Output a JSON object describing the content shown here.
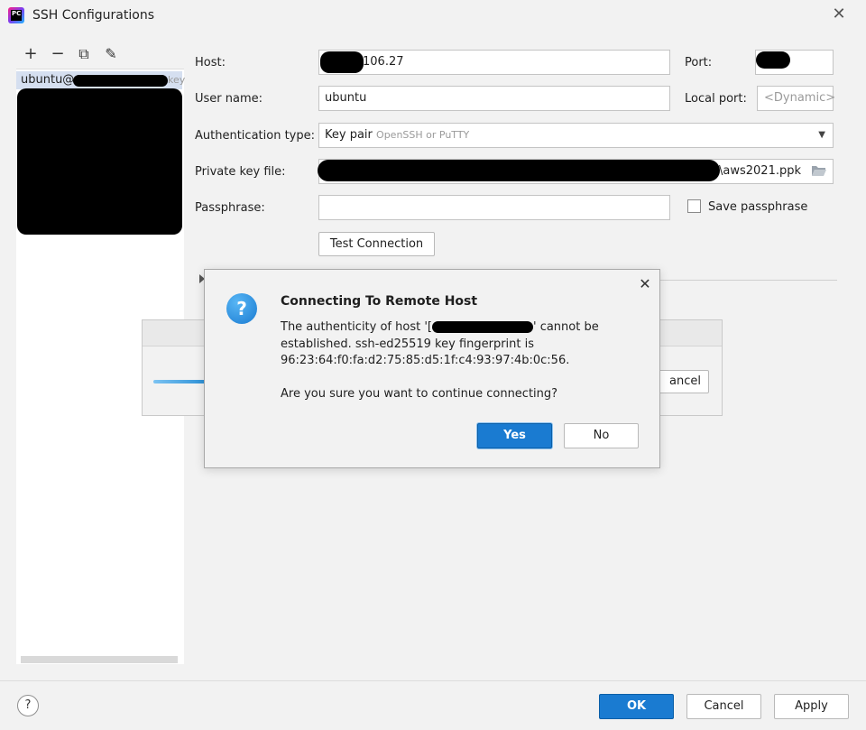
{
  "window": {
    "title": "SSH Configurations",
    "close_glyph": "✕"
  },
  "toolbar": {
    "add": "+",
    "remove": "−",
    "copy": "⧉",
    "edit": "✎"
  },
  "config_list": {
    "item_label": "ubuntu@",
    "item_suffix": "key"
  },
  "form": {
    "host_label": "Host:",
    "host_value": "106.27",
    "port_label": "Port:",
    "username_label": "User name:",
    "username_value": "ubuntu",
    "local_port_label": "Local port:",
    "local_port_placeholder": "<Dynamic>",
    "auth_type_label": "Authentication type:",
    "auth_type_value": "Key pair",
    "auth_type_hint": "OpenSSH or PuTTY",
    "private_key_label": "Private key file:",
    "private_key_value": "\\aws2021.ppk",
    "passphrase_label": "Passphrase:",
    "save_passphrase_label": "Save passphrase",
    "test_connection_label": "Test Connection"
  },
  "progress_dialog": {
    "cancel_label": "ancel"
  },
  "confirm_dialog": {
    "title": "Connecting To Remote Host",
    "line1_prefix": "The authenticity of host '[",
    "line1_suffix": "' cannot be",
    "line2": "established. ssh-ed25519 key fingerprint is",
    "line3": "96:23:64:f0:fa:d2:75:85:d5:1f:c4:93:97:4b:0c:56.",
    "question": "Are you sure you want to continue connecting?",
    "yes_label": "Yes",
    "no_label": "No",
    "icon": "question-icon"
  },
  "footer": {
    "help": "?",
    "ok_label": "OK",
    "cancel_label": "Cancel",
    "apply_label": "Apply"
  },
  "colors": {
    "primary": "#1a7bd1",
    "selection": "#d5dff0",
    "background": "#f2f2f2"
  }
}
